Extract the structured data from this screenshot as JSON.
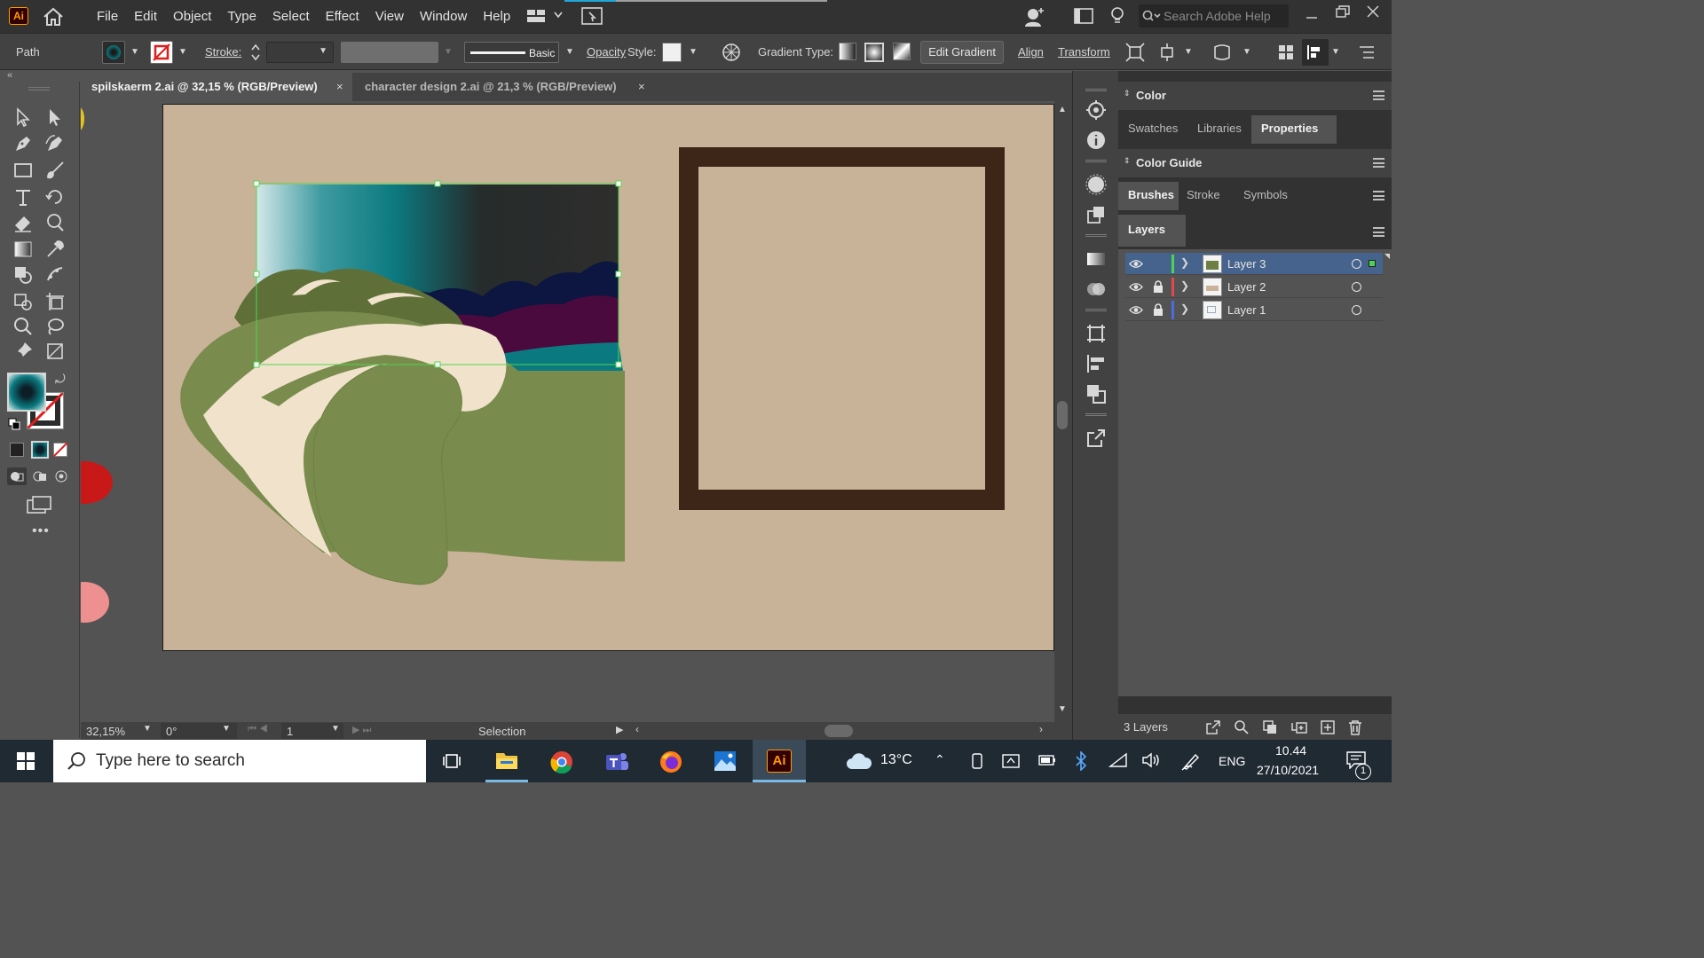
{
  "app": {
    "logo_text": "Ai",
    "menu": [
      "File",
      "Edit",
      "Object",
      "Type",
      "Select",
      "Effect",
      "View",
      "Window",
      "Help"
    ],
    "search_placeholder": "Search Adobe Help",
    "progress_fraction": 0.2
  },
  "control_bar": {
    "selection_type": "Path",
    "stroke_label": "Stroke:",
    "brush_label": "Basic",
    "opacity_label": "Opacity",
    "style_label": "Style:",
    "gradient_type_label": "Gradient Type:",
    "edit_gradient_label": "Edit Gradient",
    "align_label": "Align",
    "transform_label": "Transform"
  },
  "tabs": [
    {
      "label": "spilskaerm 2.ai @ 32,15 % (RGB/Preview)",
      "active": true
    },
    {
      "label": "character design 2.ai @ 21,3 % (RGB/Preview)",
      "active": false
    }
  ],
  "tab_close_glyph": "×",
  "status_bar": {
    "zoom": "32,15%",
    "rotation": "0°",
    "artboard": "1",
    "tool": "Selection"
  },
  "panels": {
    "color_title": "Color",
    "color_tabs": [
      "Swatches",
      "Libraries",
      "Properties"
    ],
    "color_guide_title": "Color Guide",
    "brush_tabs": [
      "Brushes",
      "Stroke",
      "Symbols"
    ],
    "layers_title": "Layers",
    "layers": [
      {
        "name": "Layer 3",
        "color": "#4fd44f",
        "locked": false,
        "selected": true
      },
      {
        "name": "Layer 2",
        "color": "#e04a4a",
        "locked": true,
        "selected": false
      },
      {
        "name": "Layer 1",
        "color": "#4a6de0",
        "locked": true,
        "selected": false
      }
    ],
    "layer_count": "3 Layers"
  },
  "taskbar": {
    "search_placeholder": "Type here to search",
    "temperature": "13°C",
    "language": "ENG",
    "time": "10.44",
    "date": "27/10/2021",
    "notification_count": "1"
  },
  "artwork_colors": {
    "background": "#c9b398",
    "frame": "#3d2518",
    "hill_light": "#7a8c4d",
    "hill_dark": "#5e7038",
    "cream": "#f1e2cc",
    "sky_teal": "#0b7a80"
  }
}
